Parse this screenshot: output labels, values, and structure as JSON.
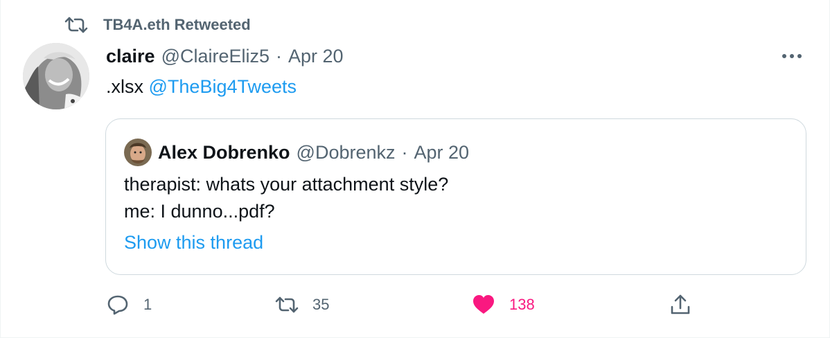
{
  "retweet_context": {
    "icon": "retweet-icon",
    "text": "TB4A.eth Retweeted"
  },
  "tweet": {
    "author_name": "claire",
    "author_handle": "@ClaireEliz5",
    "separator": "·",
    "date": "Apr 20",
    "text_prefix": ".xlsx",
    "mention": "@TheBig4Tweets",
    "more_icon": "more-icon"
  },
  "quoted_tweet": {
    "author_name": "Alex Dobrenko",
    "author_handle": "@Dobrenkz",
    "separator": "·",
    "date": "Apr 20",
    "lines": [
      "therapist: whats your attachment style?",
      "me: I dunno...pdf?"
    ],
    "show_thread": "Show this thread"
  },
  "actions": {
    "reply": {
      "icon": "reply-icon",
      "count": "1"
    },
    "retweet": {
      "icon": "retweet-icon",
      "count": "35"
    },
    "like": {
      "icon": "heart-icon",
      "count": "138",
      "active": true,
      "color": "#f91880"
    },
    "share": {
      "icon": "share-icon"
    }
  },
  "colors": {
    "link": "#1d9bf0",
    "muted": "#536471",
    "text": "#0f1419",
    "like": "#f91880"
  }
}
